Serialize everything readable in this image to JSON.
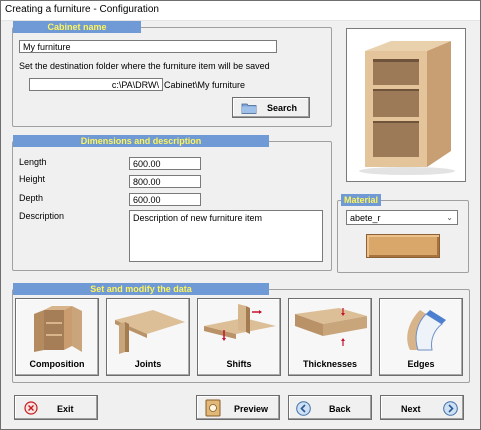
{
  "window": {
    "title": "Creating a furniture - Configuration"
  },
  "cabinet": {
    "section_title": "Cabinet name",
    "name_value": "My furniture",
    "folder_prompt": "Set the destination folder where the furniture item will be saved",
    "folder_path": "c:\\PA\\DRW\\",
    "folder_suffix": "Cabinet\\My furniture",
    "search_label": "Search"
  },
  "dimensions": {
    "section_title": "Dimensions and description",
    "length_label": "Length",
    "length_value": "600.00",
    "height_label": "Height",
    "height_value": "800.00",
    "depth_label": "Depth",
    "depth_value": "600.00",
    "description_label": "Description",
    "description_value": "Description of new furniture item"
  },
  "material": {
    "section_title": "Material",
    "selected": "abete_r",
    "swatch_color": "#d9a76a"
  },
  "modify": {
    "section_title": "Set and modify the data",
    "tiles": [
      {
        "label": "Composition",
        "icon": "cabinet-open-icon"
      },
      {
        "label": "Joints",
        "icon": "wood-joint-icon"
      },
      {
        "label": "Shifts",
        "icon": "panel-shift-icon"
      },
      {
        "label": "Thicknesses",
        "icon": "panel-thickness-icon"
      },
      {
        "label": "Edges",
        "icon": "edge-band-icon"
      }
    ]
  },
  "footer": {
    "exit_label": "Exit",
    "preview_label": "Preview",
    "back_label": "Back",
    "next_label": "Next"
  },
  "colors": {
    "banner_bg": "#6f9ad6",
    "banner_text": "#fff45a",
    "wood": "#d9b68a"
  }
}
